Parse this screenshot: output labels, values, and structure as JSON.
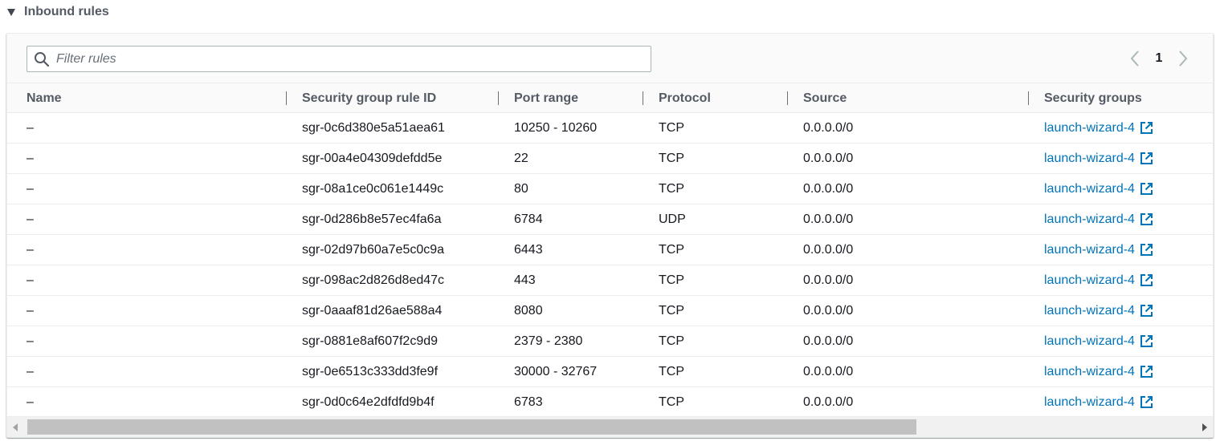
{
  "section": {
    "title": "Inbound rules"
  },
  "filter": {
    "placeholder": "Filter rules",
    "value": ""
  },
  "pagination": {
    "current_page": "1"
  },
  "columns": {
    "name": "Name",
    "rule_id": "Security group rule ID",
    "port_range": "Port range",
    "protocol": "Protocol",
    "source": "Source",
    "security_groups": "Security groups"
  },
  "rows": [
    {
      "name": "–",
      "rule_id": "sgr-0c6d380e5a51aea61",
      "port_range": "10250 - 10260",
      "protocol": "TCP",
      "source": "0.0.0.0/0",
      "security_group": "launch-wizard-4"
    },
    {
      "name": "–",
      "rule_id": "sgr-00a4e04309defdd5e",
      "port_range": "22",
      "protocol": "TCP",
      "source": "0.0.0.0/0",
      "security_group": "launch-wizard-4"
    },
    {
      "name": "–",
      "rule_id": "sgr-08a1ce0c061e1449c",
      "port_range": "80",
      "protocol": "TCP",
      "source": "0.0.0.0/0",
      "security_group": "launch-wizard-4"
    },
    {
      "name": "–",
      "rule_id": "sgr-0d286b8e57ec4fa6a",
      "port_range": "6784",
      "protocol": "UDP",
      "source": "0.0.0.0/0",
      "security_group": "launch-wizard-4"
    },
    {
      "name": "–",
      "rule_id": "sgr-02d97b60a7e5c0c9a",
      "port_range": "6443",
      "protocol": "TCP",
      "source": "0.0.0.0/0",
      "security_group": "launch-wizard-4"
    },
    {
      "name": "–",
      "rule_id": "sgr-098ac2d826d8ed47c",
      "port_range": "443",
      "protocol": "TCP",
      "source": "0.0.0.0/0",
      "security_group": "launch-wizard-4"
    },
    {
      "name": "–",
      "rule_id": "sgr-0aaaf81d26ae588a4",
      "port_range": "8080",
      "protocol": "TCP",
      "source": "0.0.0.0/0",
      "security_group": "launch-wizard-4"
    },
    {
      "name": "–",
      "rule_id": "sgr-0881e8af607f2c9d9",
      "port_range": "2379 - 2380",
      "protocol": "TCP",
      "source": "0.0.0.0/0",
      "security_group": "launch-wizard-4"
    },
    {
      "name": "–",
      "rule_id": "sgr-0e6513c333dd3fe9f",
      "port_range": "30000 - 32767",
      "protocol": "TCP",
      "source": "0.0.0.0/0",
      "security_group": "launch-wizard-4"
    },
    {
      "name": "–",
      "rule_id": "sgr-0d0c64e2dfdfd9b4f",
      "port_range": "6783",
      "protocol": "TCP",
      "source": "0.0.0.0/0",
      "security_group": "launch-wizard-4"
    }
  ],
  "icons": {
    "section_toggle": "caret-down-icon",
    "search": "search-icon",
    "pager_prev": "chevron-left-icon",
    "pager_next": "chevron-right-icon",
    "external_link": "external-link-icon",
    "scroll_left": "scroll-left-arrow-icon",
    "scroll_right": "scroll-right-arrow-icon"
  },
  "colors": {
    "link": "#0073bb",
    "header_text": "#545b64",
    "body_text": "#16191f",
    "toolbar_bg": "#fafafa",
    "border": "#eaeded"
  }
}
